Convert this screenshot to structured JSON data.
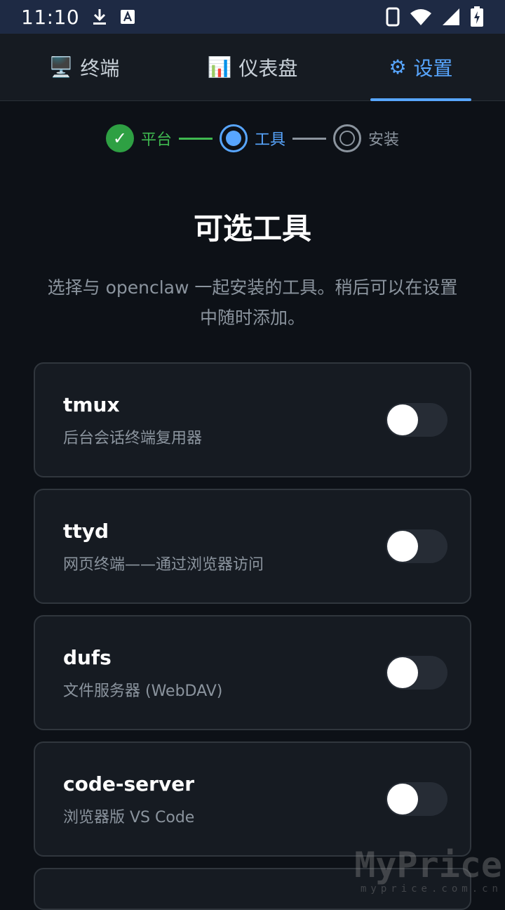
{
  "status_bar": {
    "time": "11:10",
    "icons": [
      "download-icon",
      "text-a-icon",
      "phone-icon",
      "wifi-icon",
      "signal-icon",
      "battery-charging-icon"
    ]
  },
  "tabs": [
    {
      "icon": "🖥️",
      "label": "终端",
      "active": false
    },
    {
      "icon": "📊",
      "label": "仪表盘",
      "active": false
    },
    {
      "icon": "⚙",
      "label": "设置",
      "active": true
    }
  ],
  "stepper": {
    "steps": [
      {
        "label": "平台",
        "state": "done",
        "icon": "✓"
      },
      {
        "label": "工具",
        "state": "current"
      },
      {
        "label": "安装",
        "state": "todo"
      }
    ]
  },
  "page": {
    "title": "可选工具",
    "subtitle": "选择与 openclaw 一起安装的工具。稍后可以在设置中随时添加。"
  },
  "tools": [
    {
      "name": "tmux",
      "desc": "后台会话终端复用器",
      "enabled": false
    },
    {
      "name": "ttyd",
      "desc": "网页终端——通过浏览器访问",
      "enabled": false
    },
    {
      "name": "dufs",
      "desc": "文件服务器 (WebDAV)",
      "enabled": false
    },
    {
      "name": "code-server",
      "desc": "浏览器版 VS Code",
      "enabled": false
    }
  ],
  "watermark": {
    "big": "MyPrice",
    "small": "myprice.com.cn"
  },
  "colors": {
    "accent": "#58a6ff",
    "success": "#3fb950",
    "background": "#0d1117",
    "card": "#161b22"
  }
}
